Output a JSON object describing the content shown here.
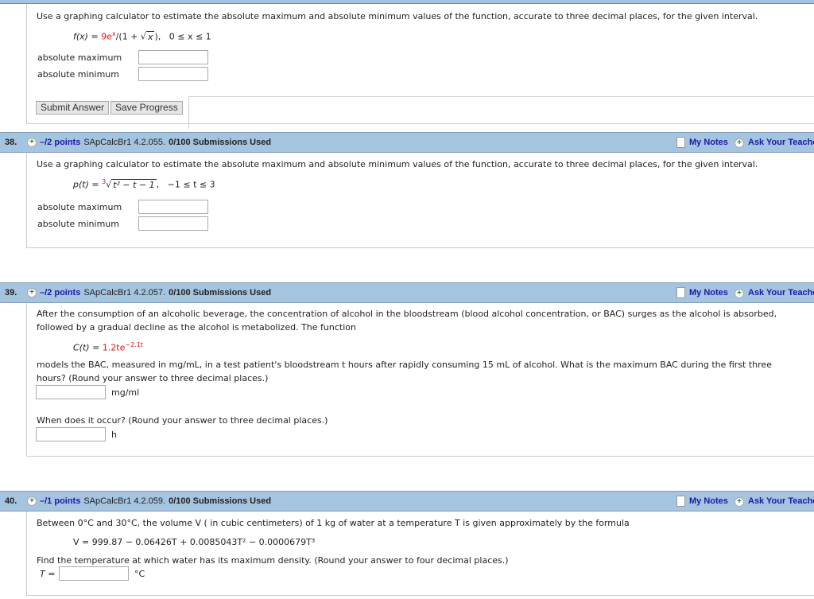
{
  "q37": {
    "prompt": "Use a graphing calculator to estimate the absolute maximum and absolute minimum values of the function, accurate to three decimal places, for the given interval.",
    "formula_lhs": "f(x) = ",
    "coef": "9e",
    "exp": "x",
    "rest1": "/(1 + ",
    "rad": "x",
    "rest2": "),",
    "interval": "0 ≤ x ≤ 1",
    "max_label": "absolute maximum",
    "min_label": "absolute minimum",
    "submit": "Submit Answer",
    "save": "Save Progress"
  },
  "questions": [
    {
      "num": "38.",
      "points": "–/2 points",
      "source": "SApCalcBr1 4.2.055.",
      "subs": "0/100 Submissions Used",
      "notes": "My Notes",
      "ask": "Ask Your Teacher"
    },
    {
      "num": "39.",
      "points": "–/2 points",
      "source": "SApCalcBr1 4.2.057.",
      "subs": "0/100 Submissions Used",
      "notes": "My Notes",
      "ask": "Ask Your Teacher"
    },
    {
      "num": "40.",
      "points": "–/1 points",
      "source": "SApCalcBr1 4.2.059.",
      "subs": "0/100 Submissions Used",
      "notes": "My Notes",
      "ask": "Ask Your Teacher"
    }
  ],
  "q38": {
    "prompt": "Use a graphing calculator to estimate the absolute maximum and absolute minimum values of the function, accurate to three decimal places, for the given interval.",
    "lhs": "p(t) = ",
    "index": "3",
    "rad": "t² − t − 1",
    "interval": "−1 ≤ t ≤ 3",
    "max_label": "absolute maximum",
    "min_label": "absolute minimum"
  },
  "q39": {
    "p1": "After the consumption of an alcoholic beverage, the concentration of alcohol in the bloodstream (blood alcohol concentration, or BAC) surges as the alcohol is absorbed,",
    "p2": "followed by a gradual decline as the alcohol is metabolized. The function",
    "lhs": "C(t) = ",
    "coef": "1.2te",
    "exp": "−2.1t",
    "p3": "models the BAC, measured in mg/mL, in a test patient's bloodstream t hours after rapidly consuming 15 mL of alcohol. What is the maximum BAC during the first three",
    "p4": "hours? (Round your answer to three decimal places.)",
    "unit1": "mg/ml",
    "p5": "When does it occur? (Round your answer to three decimal places.)",
    "unit2": "h"
  },
  "q40": {
    "p1": "Between 0°C and 30°C, the volume V ( in cubic centimeters) of 1 kg of water at a temperature T is given approximately by the formula",
    "formula": "V = 999.87 − 0.06426T + 0.0085043T² − 0.0000679T³",
    "p2": "Find the temperature at which water has its maximum density. (Round your answer to four decimal places.)",
    "tlabel": "T =",
    "unit": "°C"
  }
}
